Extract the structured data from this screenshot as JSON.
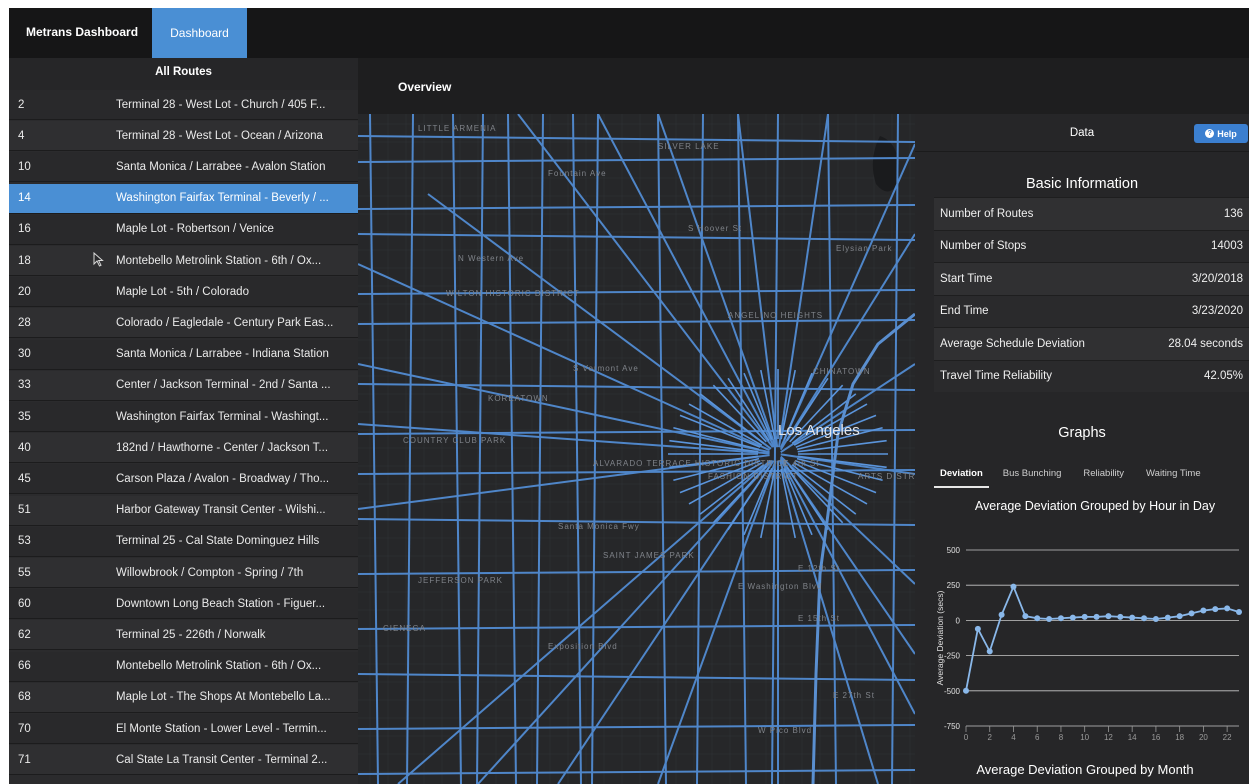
{
  "topbar": {
    "brand": "Metrans Dashboard",
    "tab": "Dashboard"
  },
  "sidebar": {
    "title": "All Routes",
    "routes": [
      {
        "num": "2",
        "name": "Terminal 28 - West Lot - Church / 405 F..."
      },
      {
        "num": "4",
        "name": "Terminal 28 - West Lot - Ocean / Arizona"
      },
      {
        "num": "10",
        "name": "Santa Monica / Larrabee - Avalon Station"
      },
      {
        "num": "14",
        "name": "Washington Fairfax Terminal - Beverly / ..."
      },
      {
        "num": "16",
        "name": "Maple Lot - Robertson / Venice"
      },
      {
        "num": "18",
        "name": "Montebello Metrolink Station - 6th / Ox..."
      },
      {
        "num": "20",
        "name": "Maple Lot - 5th / Colorado"
      },
      {
        "num": "28",
        "name": "Colorado / Eagledale - Century Park Eas..."
      },
      {
        "num": "30",
        "name": "Santa Monica / Larrabee - Indiana Station"
      },
      {
        "num": "33",
        "name": "Center / Jackson Terminal - 2nd / Santa ..."
      },
      {
        "num": "35",
        "name": "Washington Fairfax Terminal - Washingt..."
      },
      {
        "num": "40",
        "name": "182nd / Hawthorne - Center / Jackson T..."
      },
      {
        "num": "45",
        "name": "Carson Plaza / Avalon - Broadway / Tho..."
      },
      {
        "num": "51",
        "name": "Harbor Gateway Transit Center - Wilshi..."
      },
      {
        "num": "53",
        "name": "Terminal 25 - Cal State Dominguez Hills"
      },
      {
        "num": "55",
        "name": "Willowbrook / Compton - Spring / 7th"
      },
      {
        "num": "60",
        "name": "Downtown Long Beach Station - Figuer..."
      },
      {
        "num": "62",
        "name": "Terminal 25 - 226th / Norwalk"
      },
      {
        "num": "66",
        "name": "Montebello Metrolink Station - 6th / Ox..."
      },
      {
        "num": "68",
        "name": "Maple Lot - The Shops At Montebello La..."
      },
      {
        "num": "70",
        "name": "El Monte Station - Lower Level - Termin..."
      },
      {
        "num": "71",
        "name": "Cal State La Transit Center - Terminal 2..."
      }
    ],
    "selected_route": "14"
  },
  "content": {
    "title": "Overview"
  },
  "map": {
    "labels": [
      "LITTLE ARMENIA",
      "SILVER LAKE",
      "WILTON HISTORIC DISTRICT",
      "ANGELINO HEIGHTS",
      "KOREATOWN",
      "COUNTRY CLUB PARK",
      "ALVARADO TERRACE HISTORIC DISTRICT",
      "ARTS DISTRICT",
      "JEFFERSON PARK",
      "FASHION DISTRICT",
      "SAINT JAMES PARK",
      "CIENEGA",
      "CHINATOWN",
      "Sunset Blvd",
      "Fountain Ave",
      "Elysian Park",
      "Santa Monica Fwy",
      "Exposition Blvd",
      "E Washington Blvd",
      "E 15th St",
      "E 12th St",
      "E 4th St",
      "E 27th St",
      "W Pico Blvd",
      "N Western Ave",
      "S Hoover St",
      "S Vermont Ave"
    ],
    "city": "Los Angeles",
    "route_color": "#4f86c9"
  },
  "panel": {
    "title": "Data",
    "help_label": "Help",
    "basic_info_title": "Basic Information",
    "info": [
      {
        "label": "Number of Routes",
        "value": "136"
      },
      {
        "label": "Number of Stops",
        "value": "14003"
      },
      {
        "label": "Start Time",
        "value": "3/20/2018"
      },
      {
        "label": "End Time",
        "value": "3/23/2020"
      },
      {
        "label": "Average Schedule Deviation",
        "value": "28.04 seconds"
      },
      {
        "label": "Travel Time Reliability",
        "value": "42.05%"
      }
    ],
    "graphs_title": "Graphs",
    "graph_tabs": [
      "Deviation",
      "Bus Bunching",
      "Reliability",
      "Waiting Time"
    ],
    "active_graph_tab": "Deviation",
    "chart_title": "Average Deviation Grouped by Hour in Day",
    "next_chart_title": "Average Deviation Grouped by Month"
  },
  "chart_data": {
    "type": "line",
    "title": "Average Deviation Grouped by Hour in Day",
    "xlabel": "",
    "ylabel": "Average Deviation (secs)",
    "x": [
      0,
      1,
      2,
      3,
      4,
      5,
      6,
      7,
      8,
      9,
      10,
      11,
      12,
      13,
      14,
      15,
      16,
      17,
      18,
      19,
      20,
      21,
      22,
      23
    ],
    "values": [
      -500,
      -60,
      -220,
      40,
      240,
      30,
      15,
      10,
      15,
      20,
      25,
      25,
      30,
      25,
      20,
      15,
      10,
      20,
      30,
      50,
      70,
      80,
      85,
      60
    ],
    "xticks": [
      0,
      2,
      4,
      6,
      8,
      10,
      12,
      14,
      16,
      18,
      20,
      22
    ],
    "yticks": [
      500,
      250,
      0,
      -250,
      -500,
      -750
    ],
    "ylim": [
      -750,
      500
    ],
    "grid": true,
    "color": "#8ab8ea"
  }
}
